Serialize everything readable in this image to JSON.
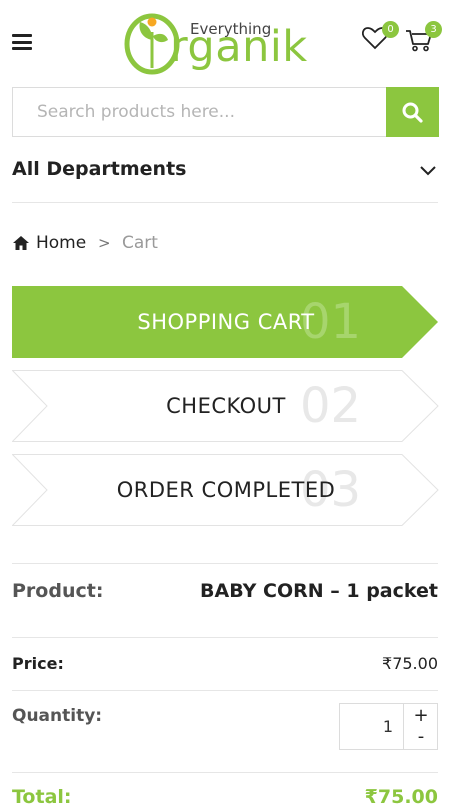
{
  "header": {
    "logo_top": "Everything",
    "logo_bottom": "rganik",
    "wishlist_count": "0",
    "cart_count": "3",
    "accent": "#8cc63f"
  },
  "search": {
    "placeholder": "Search products here..."
  },
  "departments": {
    "label": "All Departments"
  },
  "breadcrumb": {
    "home": "Home",
    "separator": ">",
    "current": "Cart"
  },
  "steps": [
    {
      "label": "SHOPPING CART",
      "number": "01",
      "active": true
    },
    {
      "label": "CHECKOUT",
      "number": "02",
      "active": false
    },
    {
      "label": "ORDER COMPLETED",
      "number": "03",
      "active": false
    }
  ],
  "cart_item": {
    "product_label": "Product:",
    "product_value": "BABY CORN – 1 packet",
    "price_label": "Price:",
    "price_value": "₹75.00",
    "quantity_label": "Quantity:",
    "quantity_value": "1",
    "plus": "+",
    "minus": "-",
    "total_label": "Total:",
    "total_value": "₹75.00"
  }
}
